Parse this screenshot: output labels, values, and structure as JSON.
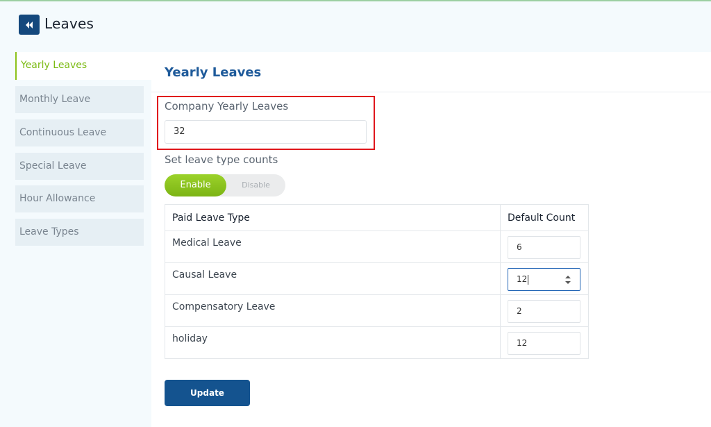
{
  "header": {
    "title": "Leaves",
    "back_icon": "double-chevron-left-icon"
  },
  "sidebar": {
    "items": [
      {
        "label": "Yearly Leaves",
        "active": true
      },
      {
        "label": "Monthly Leave",
        "active": false
      },
      {
        "label": "Continuous Leave",
        "active": false
      },
      {
        "label": "Special Leave",
        "active": false
      },
      {
        "label": "Hour Allowance",
        "active": false
      },
      {
        "label": "Leave Types",
        "active": false
      }
    ]
  },
  "main": {
    "title": "Yearly Leaves",
    "company_yearly_label": "Company Yearly Leaves",
    "company_yearly_value": "32",
    "counts_label": "Set leave type counts",
    "toggle": {
      "enable": "Enable",
      "disable": "Disable",
      "selected": "Enable"
    },
    "table": {
      "headers": [
        "Paid Leave Type",
        "Default Count"
      ],
      "rows": [
        {
          "type": "Medical Leave",
          "count": "6"
        },
        {
          "type": "Causal Leave",
          "count": "12"
        },
        {
          "type": "Compensatory Leave",
          "count": "2"
        },
        {
          "type": "holiday",
          "count": "12"
        }
      ]
    },
    "update_label": "Update"
  },
  "colors": {
    "brand_blue": "#14487d",
    "accent_green": "#7cbb15",
    "title_blue": "#1e5a9a",
    "highlight_red": "#e0161c"
  }
}
